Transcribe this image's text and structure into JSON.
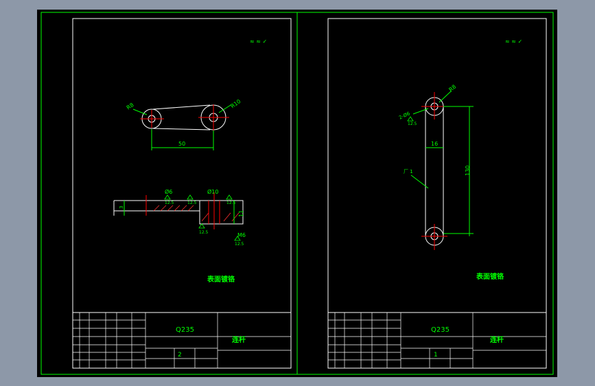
{
  "colors": {
    "background": "#8d98a8",
    "canvas": "#000000",
    "frame": "#00ff00",
    "outline": "#ffffff",
    "centerline": "#ff0000",
    "dimension": "#00ff00",
    "hatch": "#ff3030",
    "text": "#00ff00"
  },
  "left_sheet": {
    "surface_symbol": "≈ ≈ ✓",
    "dim_r_small": "R8",
    "dim_r_large": "R10",
    "dim_center_distance": "50",
    "dim_dia_small": "Ø6",
    "dim_dia_large": "Ø10",
    "dim_m6": "M6",
    "dim_height_11": "11",
    "dim_thickness": "3",
    "roughness_a": "12.5",
    "roughness_b": "12.5",
    "roughness_c": "12.5",
    "roughness_d": "12.5",
    "roughness_e": "12.5",
    "note": "表面镀铬",
    "title_block": {
      "material": "Q235",
      "part_name": "连杆",
      "quantity": "2"
    }
  },
  "right_sheet": {
    "surface_symbol": "≈ ≈ ✓",
    "dim_r": "R8",
    "dim_holes": "2-Ø6",
    "dim_roughness": "12.5",
    "dim_width": "16",
    "dim_length": "130",
    "leader_label": "厂 1",
    "note": "表面镀铬",
    "title_block": {
      "material": "Q235",
      "part_name": "连杆",
      "quantity": "1"
    }
  }
}
